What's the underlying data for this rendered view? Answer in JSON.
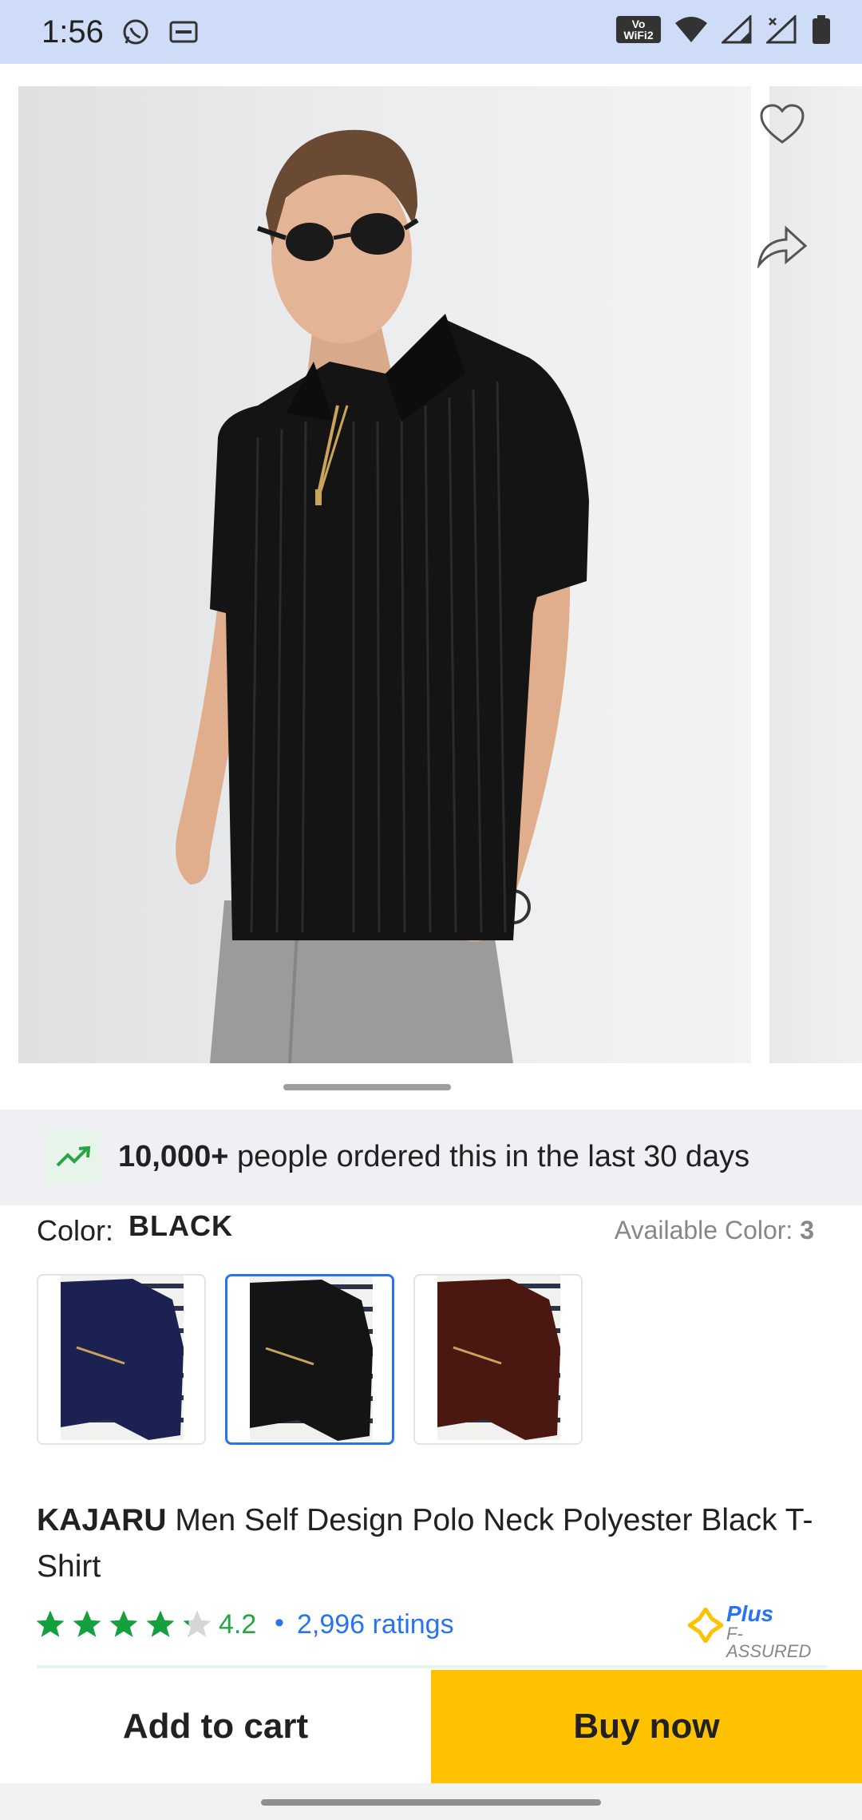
{
  "status_bar": {
    "time": "1:56",
    "left_icons": [
      "whatsapp-icon",
      "message-icon"
    ],
    "wifi_badge_top": "Vo",
    "wifi_badge_bottom": "WiFi2",
    "right_icons": [
      "vowifi-icon",
      "wifi-icon",
      "signal-icon",
      "signal-x-icon",
      "battery-icon"
    ]
  },
  "gallery": {
    "actions": [
      "heart-icon",
      "share-icon"
    ],
    "image_description_icon": "product-photo"
  },
  "trend_banner": {
    "icon": "trending-up-icon",
    "highlight": "10,000+",
    "text": " people ordered this in the last 30 days"
  },
  "color": {
    "label": "Color: ",
    "selected": "BLACK",
    "available_label": "Available Color: ",
    "available_count": "3",
    "swatches": [
      {
        "name": "navy",
        "color": "#1b2150",
        "selected": false
      },
      {
        "name": "black",
        "color": "#141414",
        "selected": true
      },
      {
        "name": "maroon",
        "color": "#4a1810",
        "selected": false
      }
    ]
  },
  "product": {
    "brand": "KAJARU",
    "title": " Men Self Design Polo Neck Polyester Black T-Shirt",
    "rating": "4.2",
    "rating_fraction": 0.84,
    "separator": "•",
    "ratings_count": "2,996 ratings",
    "assured_plus": "Plus",
    "assured_sub": "F-ASSURED"
  },
  "actions": {
    "add_to_cart": "Add to cart",
    "buy_now": "Buy now"
  },
  "colors": {
    "accent": "#2874f0",
    "rating_green": "#26a541",
    "buy_yellow": "#ffc200",
    "status_bg": "#cfdcf7"
  }
}
